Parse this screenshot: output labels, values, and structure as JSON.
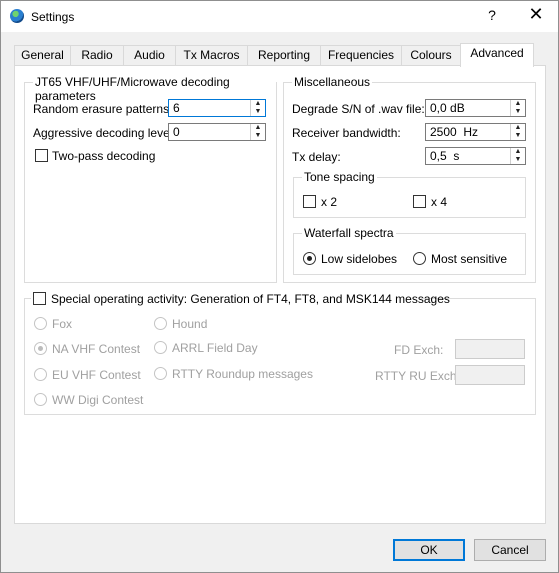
{
  "window": {
    "title": "Settings",
    "help_glyph": "?",
    "close_glyph": "✕"
  },
  "tabs": [
    {
      "label": "General"
    },
    {
      "label": "Radio"
    },
    {
      "label": "Audio"
    },
    {
      "label": "Tx Macros"
    },
    {
      "label": "Reporting"
    },
    {
      "label": "Frequencies"
    },
    {
      "label": "Colours"
    },
    {
      "label": "Advanced",
      "active": true
    }
  ],
  "jt65": {
    "title": "JT65 VHF/UHF/Microwave decoding parameters",
    "random_label": "Random erasure patterns:",
    "random_value": "6",
    "aggressive_label": "Aggressive decoding level:",
    "aggressive_value": "0",
    "twopass_label": "Two-pass decoding"
  },
  "misc": {
    "title": "Miscellaneous",
    "degrade_label": "Degrade S/N of .wav file:",
    "degrade_value": "0,0 dB",
    "bandwidth_label": "Receiver bandwidth:",
    "bandwidth_value": "2500  Hz",
    "txdelay_label": "Tx delay:",
    "txdelay_value": "0,5  s",
    "tone": {
      "title": "Tone spacing",
      "x2": "x 2",
      "x4": "x 4"
    },
    "waterfall": {
      "title": "Waterfall spectra",
      "low": "Low sidelobes",
      "most": "Most sensitive"
    }
  },
  "special": {
    "title": "Special operating activity:  Generation of FT4, FT8, and MSK144 messages",
    "fox": "Fox",
    "hound": "Hound",
    "na_vhf": "NA VHF Contest",
    "arrl_fd": "ARRL Field Day",
    "eu_vhf": "EU VHF Contest",
    "rtty": "RTTY Roundup messages",
    "ww_digi": "WW Digi Contest",
    "fd_exch_label": "FD Exch:",
    "rtty_exch_label": "RTTY RU Exch:"
  },
  "buttons": {
    "ok": "OK",
    "cancel": "Cancel"
  }
}
